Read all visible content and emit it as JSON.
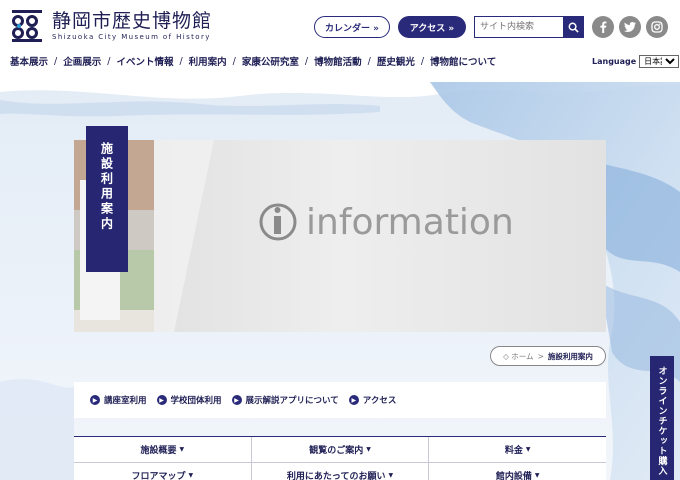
{
  "header": {
    "logo_title": "静岡市歴史博物館",
    "logo_subtitle": "Shizuoka City Museum of History",
    "calendar_label": "カレンダー »",
    "access_label": "アクセス »",
    "search_placeholder": "サイト内検索",
    "language_label": "Language",
    "language_value": "日本語"
  },
  "nav": {
    "items": [
      "基本展示",
      "企画展示",
      "イベント情報",
      "利用案内",
      "家康公研究室",
      "博物館活動",
      "歴史観光",
      "博物館について"
    ],
    "separator": "/"
  },
  "hero": {
    "page_title": "施設利用案内",
    "image_text": "information"
  },
  "breadcrumb": {
    "home": "◇ ホーム",
    "arrow": ">",
    "current": "施設利用案内"
  },
  "subnav": {
    "items": [
      "講座室利用",
      "学校団体利用",
      "展示解説アプリについて",
      "アクセス"
    ]
  },
  "grid": {
    "rows": [
      [
        "施設概要",
        "観覧のご案内",
        "料金"
      ],
      [
        "フロアマップ",
        "利用にあたってのお願い",
        "館内設備"
      ]
    ]
  },
  "ticket": {
    "label": "オンラインチケット購入"
  },
  "colors": {
    "brand_navy": "#262672",
    "accent_blue": "#2ea0d8",
    "sns_gray": "#8a8a8a"
  },
  "icons": {
    "search": "search-icon",
    "facebook": "facebook-icon",
    "twitter": "twitter-icon",
    "instagram": "instagram-icon",
    "arrow": "arrow-circle-icon",
    "dropdown": "triangle-down-icon"
  }
}
